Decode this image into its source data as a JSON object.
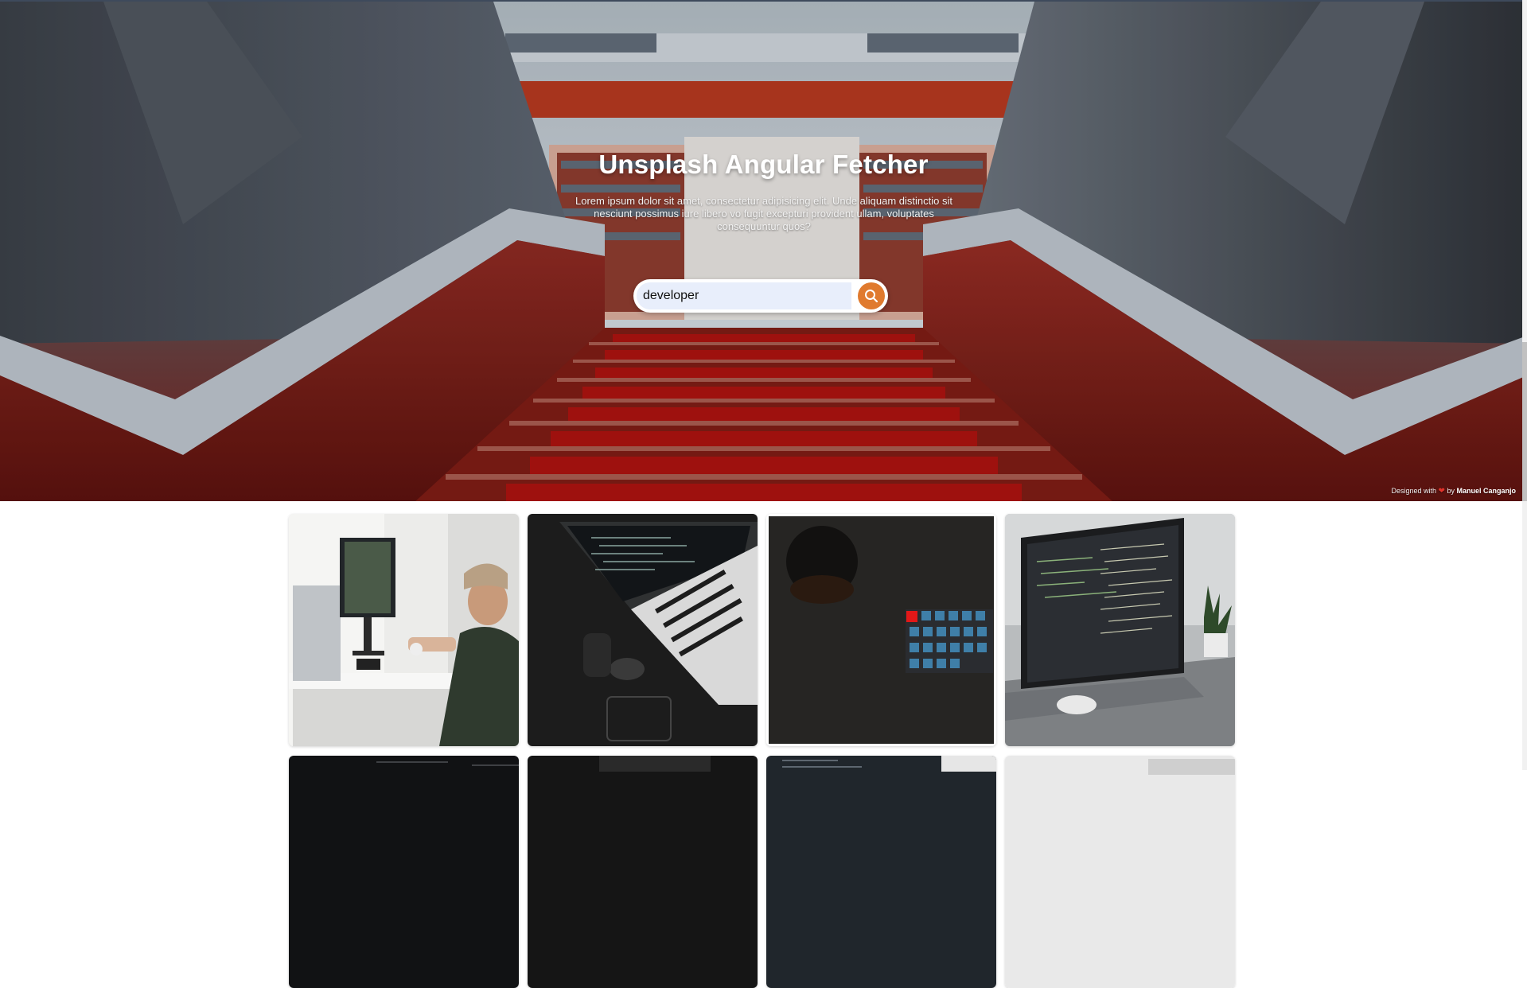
{
  "hero": {
    "title": "Unsplash Angular Fetcher",
    "description": "Lorem ipsum dolor sit amet, consectetur adipisicing elit. Unde aliquam distinctio sit nesciunt possimus iure libero vo fugit excepturi provident ullam, voluptates consequuntur quos?"
  },
  "search": {
    "value": "developer",
    "button_icon": "search-icon"
  },
  "credit": {
    "prefix": "Designed with",
    "heart": "❤",
    "by": "by",
    "author": "Manuel Canganjo"
  },
  "colors": {
    "accent": "#e07a2e",
    "input_bg": "#e8eefb",
    "carpet_red": "#a8130f"
  },
  "gallery": {
    "photos": [
      {
        "subject": "man-at-computer-with-headphones"
      },
      {
        "subject": "laptop-code-mouse-dark-desk"
      },
      {
        "subject": "coffee-cup-keyboard-dark"
      },
      {
        "subject": "laptop-code-editor-plant"
      },
      {
        "subject": "dark-code-screen"
      },
      {
        "subject": "dark-desk"
      },
      {
        "subject": "code-screen-hand"
      },
      {
        "subject": "light-workspace"
      }
    ]
  }
}
